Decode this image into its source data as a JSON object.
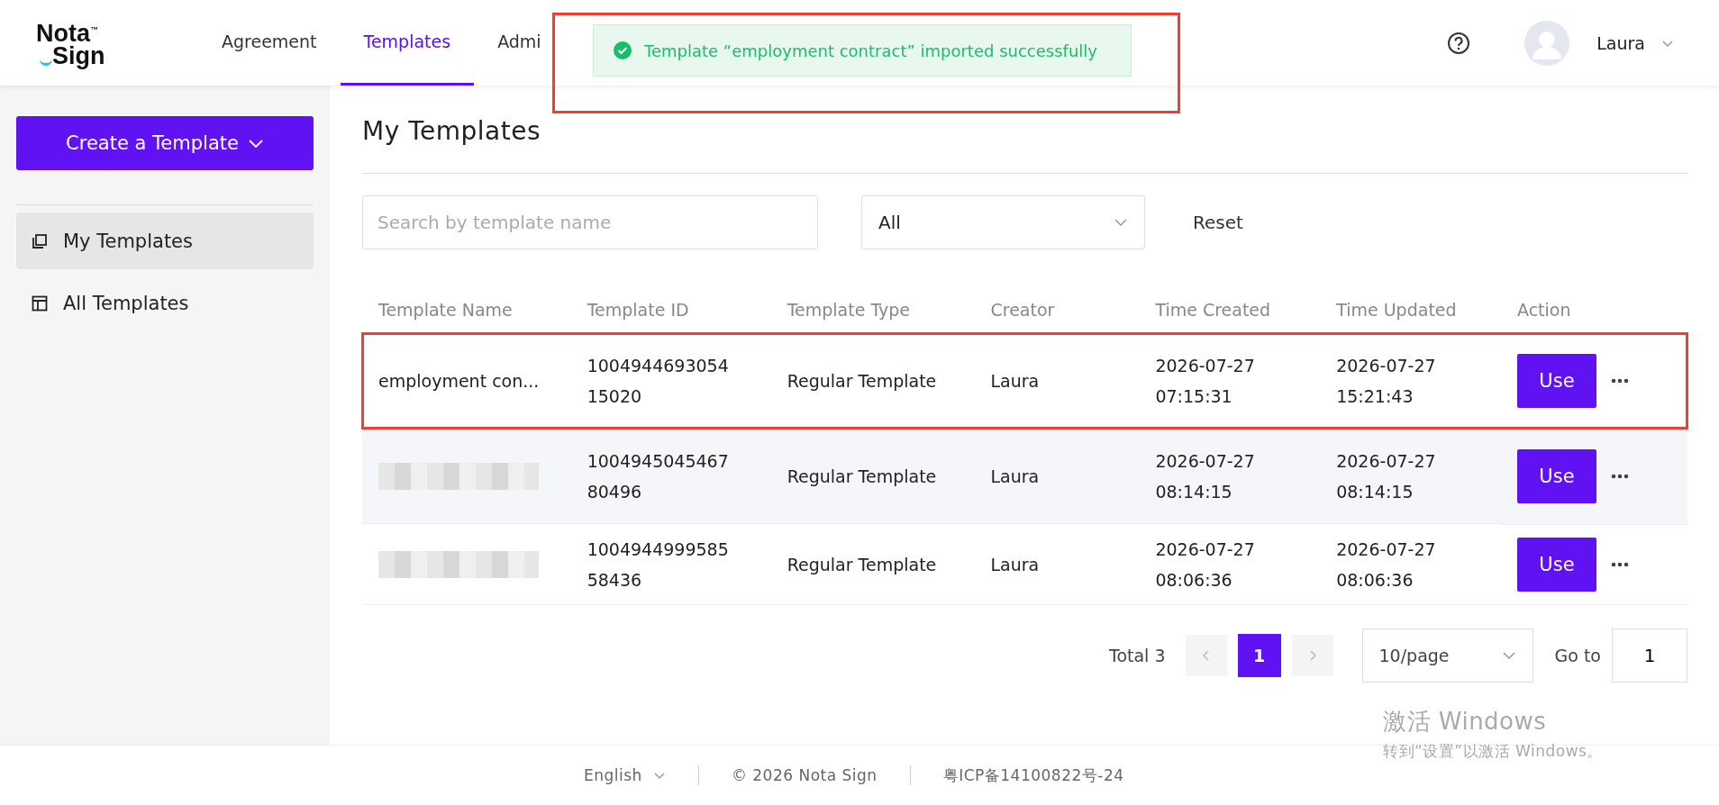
{
  "header": {
    "logo_top": "Nota",
    "logo_bottom": "Sign",
    "logo_mark": "™",
    "nav": [
      {
        "label": "Agreement",
        "selected": false
      },
      {
        "label": "Templates",
        "selected": true
      },
      {
        "label": "Admi",
        "selected": false
      }
    ],
    "user": "Laura"
  },
  "toast": {
    "message": "Template “employment contract” imported successfully",
    "annotated": true
  },
  "sidebar": {
    "create_button": "Create a Template",
    "items": [
      {
        "label": "My Templates",
        "kind": "copy",
        "selected": true
      },
      {
        "label": "All Templates",
        "kind": "layout",
        "selected": false
      }
    ]
  },
  "page_title": "My Templates",
  "search": {
    "placeholder": "Search by template name"
  },
  "filter": {
    "value": "All"
  },
  "reset": "Reset",
  "table": {
    "columns": [
      "Template Name",
      "Template ID",
      "Template Type",
      "Creator",
      "Time Created",
      "Time Updated",
      "Action"
    ],
    "rows": [
      {
        "name": "employment con...",
        "redacted": false,
        "id": [
          "1004944693054",
          "15020"
        ],
        "type": "Regular Template",
        "creator": "Laura",
        "created": [
          "2026-07-27",
          "07:15:31"
        ],
        "updated": [
          "2026-07-27",
          "15:21:43"
        ],
        "action": "Use",
        "annotated": true
      },
      {
        "name": "",
        "redacted": true,
        "id": [
          "1004945045467",
          "80496"
        ],
        "type": "Regular Template",
        "creator": "Laura",
        "created": [
          "2026-07-27",
          "08:14:15"
        ],
        "updated": [
          "2026-07-27",
          "08:14:15"
        ],
        "action": "Use",
        "annotated": false
      },
      {
        "name": "",
        "redacted": true,
        "id": [
          "1004944999585",
          "58436"
        ],
        "type": "Regular Template",
        "creator": "Laura",
        "created": [
          "2026-07-27",
          "08:06:36"
        ],
        "updated": [
          "2026-07-27",
          "08:06:36"
        ],
        "action": "Use",
        "annotated": false
      }
    ]
  },
  "pagination": {
    "total": "Total 3",
    "pages": [
      {
        "label": "1",
        "selected": true
      }
    ],
    "page_size": "10/page",
    "goto_label": "Go to",
    "goto_value": "1"
  },
  "footer": {
    "language": "English",
    "copyright": "© 2026 Nota Sign",
    "icp": "粤ICP备14100822号-24"
  },
  "os_notice": {
    "title": "激活 Windows",
    "subtitle": "转到“设置”以激活 Windows。"
  }
}
